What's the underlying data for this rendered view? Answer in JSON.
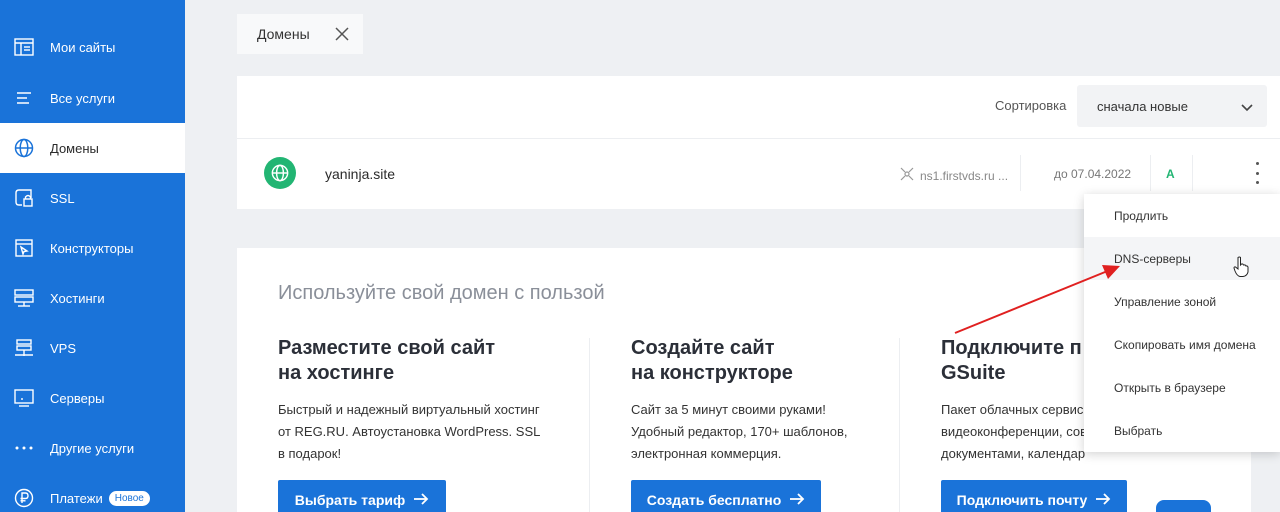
{
  "sidebar": {
    "items": [
      {
        "label": "Мои сайты",
        "icon": "sites-icon"
      },
      {
        "label": "Все услуги",
        "icon": "list-icon"
      },
      {
        "label": "Домены",
        "icon": "globe-icon"
      },
      {
        "label": "SSL",
        "icon": "ssl-lock-icon"
      },
      {
        "label": "Конструкторы",
        "icon": "constructor-icon"
      },
      {
        "label": "Хостинги",
        "icon": "hosting-icon"
      },
      {
        "label": "VPS",
        "icon": "vps-icon"
      },
      {
        "label": "Серверы",
        "icon": "server-icon"
      },
      {
        "label": "Другие услуги",
        "icon": "more-icon"
      },
      {
        "label": "Платежи",
        "icon": "ruble-icon",
        "badge": "Новое"
      }
    ]
  },
  "tab": {
    "label": "Домены"
  },
  "sort": {
    "label": "Сортировка",
    "selected": "сначала новые"
  },
  "domain": {
    "name": "yaninja.site",
    "ns": "ns1.firstvds.ru ...",
    "expiry": "до 07.04.2022",
    "status": "A"
  },
  "promo": {
    "title": "Используйте свой домен с пользой",
    "cards": [
      {
        "title": "Разместите свой сайт\nна хостинге",
        "text": "Быстрый и надежный виртуальный хостинг\nот REG.RU. Автоустановка WordPress. SSL\nв подарок!",
        "button": "Выбрать тариф"
      },
      {
        "title": "Создайте сайт\nна конструкторе",
        "text": "Сайт за 5 минут своими руками!\nУдобный редактор, 170+ шаблонов,\nэлектронная коммерция.",
        "button": "Создать бесплатно"
      },
      {
        "title": "Подключите п\nGSuite",
        "text": "Пакет облачных сервисо\nвидеоконференции, сов\nдокументами, календар",
        "button": "Подключить почту"
      }
    ]
  },
  "menu": {
    "items": [
      "Продлить",
      "DNS-серверы",
      "Управление зоной",
      "Скопировать имя домена",
      "Открыть в браузере",
      "Выбрать"
    ]
  },
  "colors": {
    "brand": "#1a73d9",
    "success": "#22b573",
    "annotation": "#e02020"
  }
}
